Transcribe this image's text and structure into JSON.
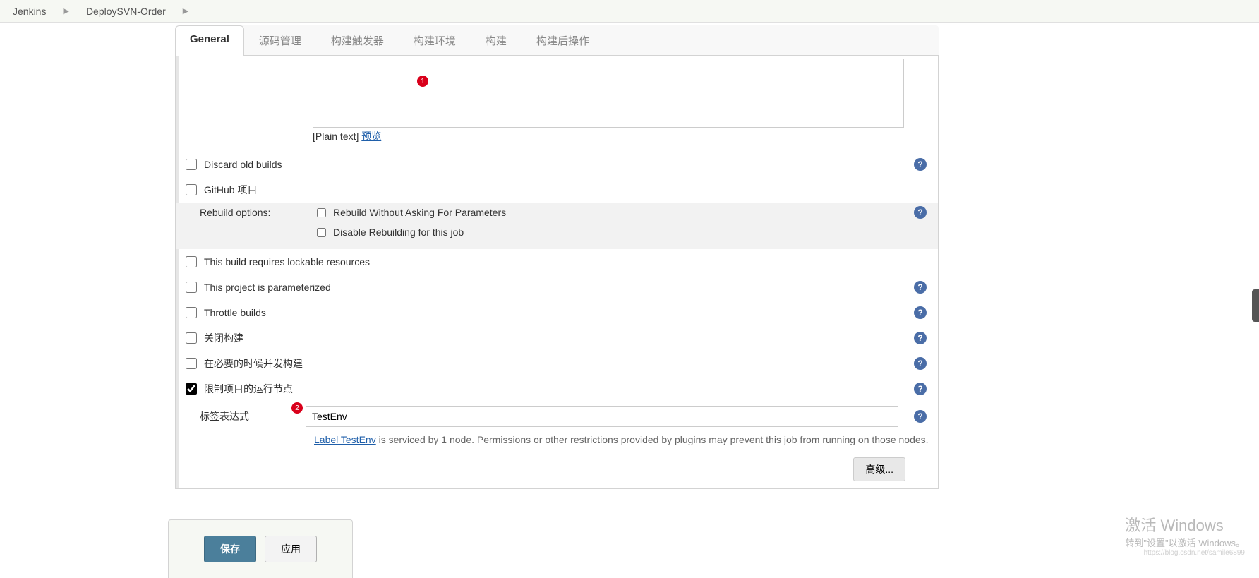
{
  "breadcrumb": {
    "root": "Jenkins",
    "job": "DeploySVN-Order"
  },
  "tabs": {
    "general": "General",
    "scm": "源码管理",
    "triggers": "构建触发器",
    "env": "构建环境",
    "build": "构建",
    "post": "构建后操作"
  },
  "badges": {
    "one": "1",
    "two": "2"
  },
  "desc": {
    "plain_prefix": "[Plain text] ",
    "preview": "预览"
  },
  "checks": {
    "discard": "Discard old builds",
    "github": "GitHub 项目",
    "rebuild_label": "Rebuild options:",
    "rebuild_without": "Rebuild Without Asking For Parameters",
    "disable_rebuild": "Disable Rebuilding for this job",
    "lockable": "This build requires lockable resources",
    "parameterized": "This project is parameterized",
    "throttle": "Throttle builds",
    "disable_build": "关闭构建",
    "concurrent": "在必要的时候并发构建",
    "restrict": "限制项目的运行节点"
  },
  "label_expr": {
    "label": "标签表达式",
    "value": "TestEnv",
    "hint_link": "Label TestEnv",
    "hint_rest": " is serviced by 1 node. Permissions or other restrictions provided by plugins may prevent this job from running on those nodes."
  },
  "buttons": {
    "save": "保存",
    "apply": "应用",
    "advanced": "高级..."
  },
  "watermark": {
    "line1": "激活 Windows",
    "line2": "转到\"设置\"以激活 Windows。",
    "line3": "https://blog.csdn.net/samile6899"
  },
  "help": "?"
}
